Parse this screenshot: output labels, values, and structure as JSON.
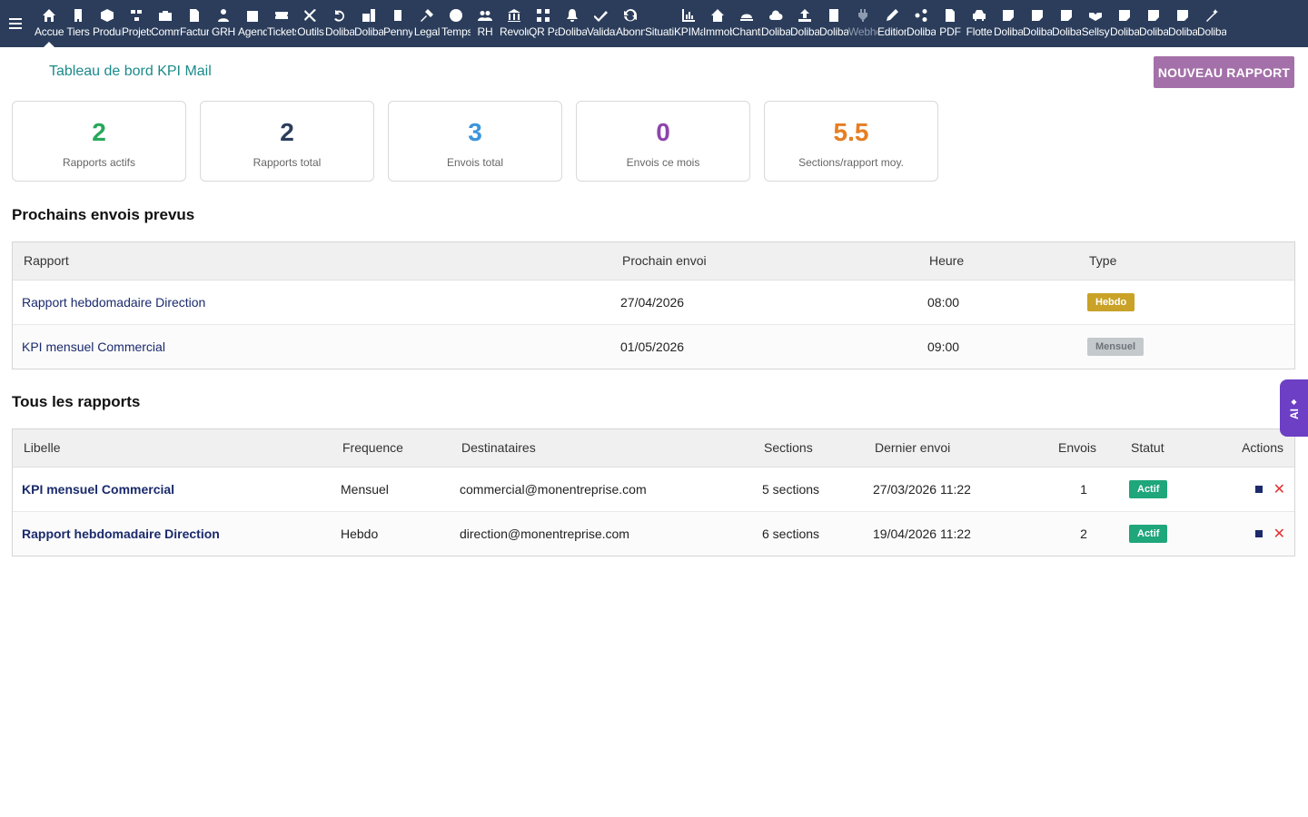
{
  "menu": [
    {
      "label": "Accueil",
      "icon": "home-icon",
      "active": true
    },
    {
      "label": "Tiers",
      "icon": "building-icon"
    },
    {
      "label": "Produits",
      "icon": "cube-icon"
    },
    {
      "label": "Projets",
      "icon": "project-icon"
    },
    {
      "label": "Commerce",
      "icon": "briefcase-icon"
    },
    {
      "label": "Facturation",
      "icon": "invoice-icon"
    },
    {
      "label": "GRH",
      "icon": "user-tie-icon"
    },
    {
      "label": "Agenda",
      "icon": "calendar-icon"
    },
    {
      "label": "Tickets",
      "icon": "ticket-icon"
    },
    {
      "label": "Outils",
      "icon": "tools-icon"
    },
    {
      "label": "Dolibarr",
      "icon": "undo-icon"
    },
    {
      "label": "Dolibarr",
      "icon": "briefcase-doc-icon"
    },
    {
      "label": "Pennylane",
      "icon": "doc-icon"
    },
    {
      "label": "Legal",
      "icon": "gavel-icon"
    },
    {
      "label": "Temps",
      "icon": "clock-icon"
    },
    {
      "label": "RH",
      "icon": "users-icon"
    },
    {
      "label": "Revolut",
      "icon": "bank-icon"
    },
    {
      "label": "QR Pay",
      "icon": "qrcode-icon"
    },
    {
      "label": "Dolibarr",
      "icon": "bell-icon"
    },
    {
      "label": "Validation",
      "icon": "double-check-icon"
    },
    {
      "label": "Abonnements",
      "icon": "sync-icon"
    },
    {
      "label": "Situations",
      "icon": "blank-icon"
    },
    {
      "label": "KPIMail",
      "icon": "chart-icon"
    },
    {
      "label": "Immobilier",
      "icon": "house-icon"
    },
    {
      "label": "Chantiers",
      "icon": "hardhat-icon"
    },
    {
      "label": "Dolibarr",
      "icon": "cloud-icon"
    },
    {
      "label": "Dolibarr",
      "icon": "upload-icon"
    },
    {
      "label": "Dolibarr",
      "icon": "building-doc-icon"
    },
    {
      "label": "Webhook",
      "icon": "plug-icon",
      "dim": true
    },
    {
      "label": "Editions",
      "icon": "edit-icon"
    },
    {
      "label": "Dolibarr",
      "icon": "share-icon"
    },
    {
      "label": "PDF",
      "icon": "pdf-icon"
    },
    {
      "label": "Flotte",
      "icon": "car-icon"
    },
    {
      "label": "Dolibarr",
      "icon": "note-icon"
    },
    {
      "label": "Dolibarr",
      "icon": "note-icon"
    },
    {
      "label": "Dolibarr",
      "icon": "note-icon"
    },
    {
      "label": "Sellsy",
      "icon": "handshake-icon"
    },
    {
      "label": "Dolibarr",
      "icon": "note-icon"
    },
    {
      "label": "Dolibarr",
      "icon": "note-icon"
    },
    {
      "label": "Dolibarr",
      "icon": "note-icon"
    },
    {
      "label": "Dolibarr",
      "icon": "magic-icon"
    }
  ],
  "page": {
    "title": "Tableau de bord KPI Mail",
    "new_report_label": "NOUVEAU RAPPORT"
  },
  "stats": [
    {
      "value": "2",
      "label": "Rapports actifs",
      "color": "#27a85a"
    },
    {
      "value": "2",
      "label": "Rapports total",
      "color": "#2b3d5b"
    },
    {
      "value": "3",
      "label": "Envois total",
      "color": "#3b95dd"
    },
    {
      "value": "0",
      "label": "Envois ce mois",
      "color": "#8e44ad"
    },
    {
      "value": "5.5",
      "label": "Sections/rapport moy.",
      "color": "#e67e22"
    }
  ],
  "upcoming": {
    "title": "Prochains envois prevus",
    "headers": [
      "Rapport",
      "Prochain envoi",
      "Heure",
      "Type"
    ],
    "rows": [
      {
        "report": "Rapport hebdomadaire Direction",
        "date": "27/04/2026",
        "time": "08:00",
        "type": "Hebdo",
        "type_color": "#c9a227"
      },
      {
        "report": "KPI mensuel Commercial",
        "date": "01/05/2026",
        "time": "09:00",
        "type": "Mensuel",
        "type_color": "#c4c9cc"
      }
    ]
  },
  "all_reports": {
    "title": "Tous les rapports",
    "headers": [
      "Libelle",
      "Frequence",
      "Destinataires",
      "Sections",
      "Dernier envoi",
      "Envois",
      "Statut",
      "Actions"
    ],
    "rows": [
      {
        "label": "KPI mensuel Commercial",
        "frequency": "Mensuel",
        "recipients": "commercial@monentreprise.com",
        "sections": "5 sections",
        "last_sent": "27/03/2026 11:22",
        "count": "1",
        "status": "Actif"
      },
      {
        "label": "Rapport hebdomadaire Direction",
        "frequency": "Hebdo",
        "recipients": "direction@monentreprise.com",
        "sections": "6 sections",
        "last_sent": "19/04/2026 11:22",
        "count": "2",
        "status": "Actif"
      }
    ],
    "status_color": "#1fa67a",
    "delete_glyph": "✕"
  },
  "ai_tab": {
    "label": "AI",
    "glyph": "◆"
  }
}
